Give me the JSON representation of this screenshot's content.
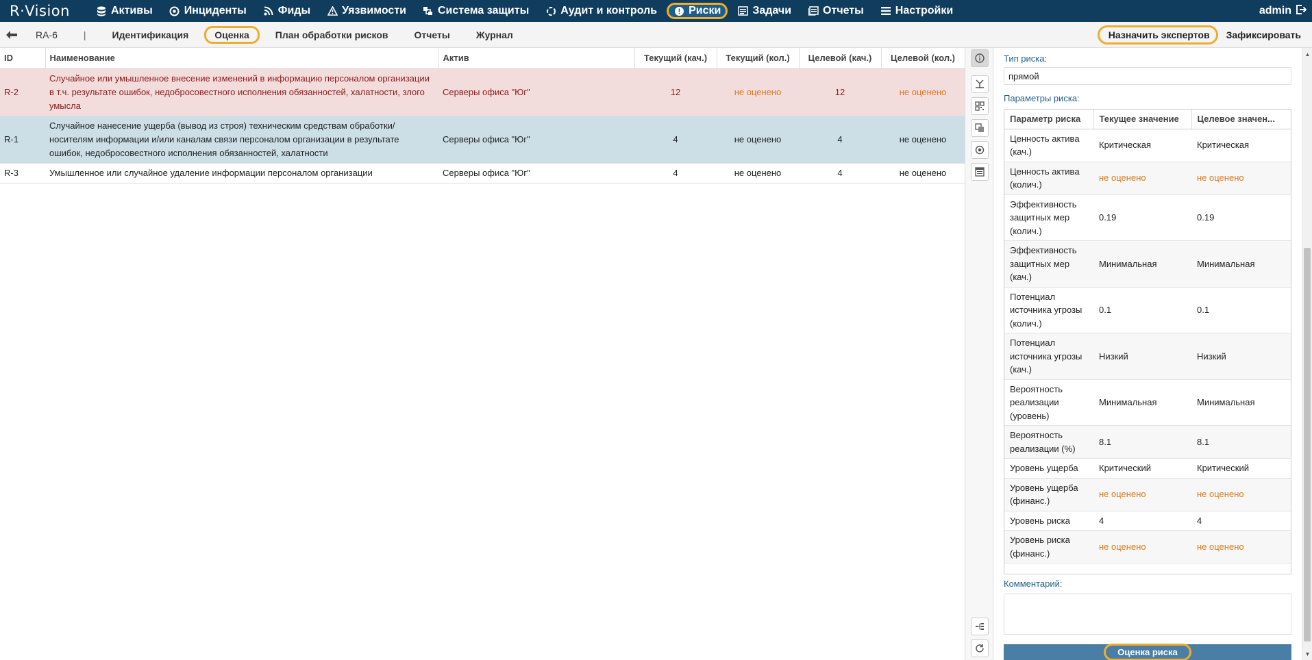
{
  "app": {
    "logo": "R·Vision",
    "user": "admin"
  },
  "nav": [
    {
      "label": "Активы",
      "icon": "database-icon"
    },
    {
      "label": "Инциденты",
      "icon": "target-icon"
    },
    {
      "label": "Фиды",
      "icon": "rss-icon"
    },
    {
      "label": "Уязвимости",
      "icon": "warning-icon"
    },
    {
      "label": "Система защиты",
      "icon": "blocks-icon"
    },
    {
      "label": "Аудит и контроль",
      "icon": "cycle-icon"
    },
    {
      "label": "Риски",
      "icon": "alert-circle-icon",
      "active": true
    },
    {
      "label": "Задачи",
      "icon": "list-icon"
    },
    {
      "label": "Отчеты",
      "icon": "report-icon"
    },
    {
      "label": "Настройки",
      "icon": "menu-icon"
    }
  ],
  "subbar": {
    "record_id": "RA-6",
    "separator": "|",
    "tabs": [
      "Идентификация",
      "Оценка",
      "План обработки рисков",
      "Отчеты",
      "Журнал"
    ],
    "active_tab": "Оценка",
    "assign_experts": "Назначить экспертов",
    "fix": "Зафиксировать"
  },
  "risk_table": {
    "columns": [
      "ID",
      "Наименование",
      "Актив",
      "Текущий (кач.)",
      "Текущий (кол.)",
      "Целевой (кач.)",
      "Целевой (кол.)"
    ],
    "rows": [
      {
        "id": "R-2",
        "name": "Случайное или умышленное внесение изменений в информацию персоналом организации в т.ч. результате ошибок, недобросовестного исполнения обязанностей, халатности, злого умысла",
        "asset": "Серверы офиса \"Юг\"",
        "cur_q": "12",
        "cur_n": "не оценено",
        "tgt_q": "12",
        "tgt_n": "не оценено",
        "style": "high"
      },
      {
        "id": "R-1",
        "name": "Случайное нанесение ущерба (вывод из строя) техническим средствам обработки/носителям информации и/или каналам связи персоналом организации в результате ошибок, недобросовестного исполнения обязанностей, халатности",
        "asset": "Серверы офиса \"Юг\"",
        "cur_q": "4",
        "cur_n": "не оценено",
        "tgt_q": "4",
        "tgt_n": "не оценено",
        "style": "sel"
      },
      {
        "id": "R-3",
        "name": "Умышленное или случайное удаление информации персоналом организации",
        "asset": "Серверы офиса \"Юг\"",
        "cur_q": "4",
        "cur_n": "не оценено",
        "tgt_q": "4",
        "tgt_n": "не оценено",
        "style": "norm"
      }
    ]
  },
  "panel": {
    "risk_type_label": "Тип риска:",
    "risk_type_value": "прямой",
    "params_label": "Параметры риска:",
    "params_columns": [
      "Параметр риска",
      "Текущее значение",
      "Целевое значен..."
    ],
    "params": [
      {
        "name": "Ценность актива (кач.)",
        "cur": "Критическая",
        "tgt": "Критическая"
      },
      {
        "name": "Ценность актива (колич.)",
        "cur": "не оценено",
        "tgt": "не оценено",
        "unrated": true
      },
      {
        "name": "Эффективность защитных мер (колич.)",
        "cur": "0.19",
        "tgt": "0.19"
      },
      {
        "name": "Эффективность защитных мер (кач.)",
        "cur": "Минимальная",
        "tgt": "Минимальная"
      },
      {
        "name": "Потенциал источника угрозы (колич.)",
        "cur": "0.1",
        "tgt": "0.1"
      },
      {
        "name": "Потенциал источника угрозы (кач.)",
        "cur": "Низкий",
        "tgt": "Низкий"
      },
      {
        "name": "Вероятность реализации (уровень)",
        "cur": "Минимальная",
        "tgt": "Минимальная"
      },
      {
        "name": "Вероятность реализации (%)",
        "cur": "8.1",
        "tgt": "8.1"
      },
      {
        "name": "Уровень ущерба",
        "cur": "Критический",
        "tgt": "Критический"
      },
      {
        "name": "Уровень ущерба (финанс.)",
        "cur": "не оценено",
        "tgt": "не оценено",
        "unrated": true
      },
      {
        "name": "Уровень риска",
        "cur": "4",
        "tgt": "4"
      },
      {
        "name": "Уровень риска (финанс.)",
        "cur": "не оценено",
        "tgt": "не оценено",
        "unrated": true
      }
    ],
    "comment_label": "Комментарий:",
    "assess_button": "Оценка риска"
  },
  "side_tools": [
    "info-icon",
    "merge-icon",
    "qr-icon",
    "copy-icon",
    "target-icon",
    "table-icon",
    "tree-icon",
    "refresh-icon"
  ],
  "colors": {
    "nav_bg": "#103d5d",
    "highlight": "#f0ad2c",
    "high_row": "#f3dcdc",
    "selected_row": "#ccdee6",
    "unrated": "#d97a1a"
  }
}
